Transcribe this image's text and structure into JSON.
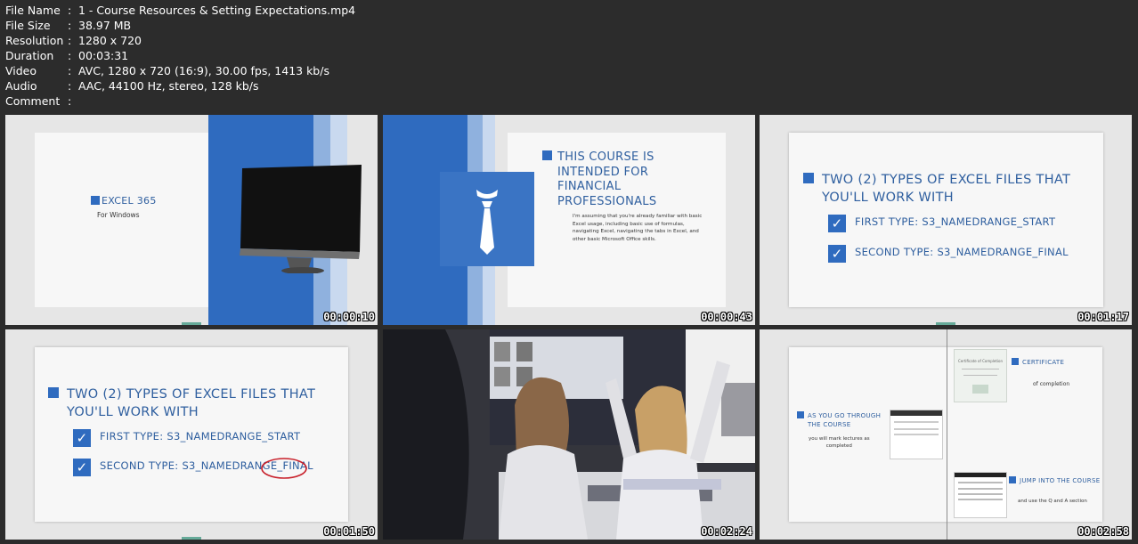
{
  "file_info": {
    "rows": [
      {
        "key": "File Name",
        "value": "1 - Course Resources & Setting Expectations.mp4"
      },
      {
        "key": "File Size",
        "value": "38.97 MB"
      },
      {
        "key": "Resolution",
        "value": "1280 x 720"
      },
      {
        "key": "Duration",
        "value": "00:03:31"
      },
      {
        "key": "Video",
        "value": "AVC, 1280 x 720 (16:9), 30.00 fps, 1413 kb/s"
      },
      {
        "key": "Audio",
        "value": "AAC, 44100 Hz, stereo, 128 kb/s"
      },
      {
        "key": "Comment",
        "value": ""
      }
    ],
    "separator": ":"
  },
  "thumbnails": [
    {
      "timestamp": "00:00:10",
      "title": "EXCEL 365",
      "subtitle": "For Windows"
    },
    {
      "timestamp": "00:00:43",
      "title_lines": [
        "THIS COURSE IS",
        "INTENDED FOR",
        "FINANCIAL",
        "PROFESSIONALS"
      ],
      "body": "I'm assuming that you're already familiar with basic Excel usage, including basic use of formulas, navigating Excel, navigating the tabs in Excel, and other basic Microsoft Office skills."
    },
    {
      "timestamp": "00:01:17",
      "title_lines": [
        "TWO (2) TYPES OF EXCEL FILES THAT",
        "YOU'LL WORK WITH"
      ],
      "items": [
        "FIRST TYPE: S3_NAMEDRANGE_START",
        "SECOND TYPE: S3_NAMEDRANGE_FINAL"
      ]
    },
    {
      "timestamp": "00:01:50",
      "title_lines": [
        "TWO (2) TYPES OF EXCEL FILES THAT",
        "YOU'LL WORK WITH"
      ],
      "items": [
        "FIRST TYPE: S3_NAMEDRANGE_START",
        "SECOND TYPE: S3_NAMEDRANGE_",
        "FINAL"
      ]
    },
    {
      "timestamp": "00:02:24"
    },
    {
      "timestamp": "00:02:58",
      "cert_title": "CERTIFICATE",
      "cert_sub": "of completion",
      "go_title_lines": [
        "AS YOU GO THROUGH",
        "THE COURSE"
      ],
      "go_sub_lines": [
        "you will mark lectures as",
        "completed"
      ],
      "jump_title": "JUMP INTO THE COURSE",
      "jump_sub": "and use the Q and A section",
      "cert_doc_title": "Certificate of Completion"
    }
  ]
}
